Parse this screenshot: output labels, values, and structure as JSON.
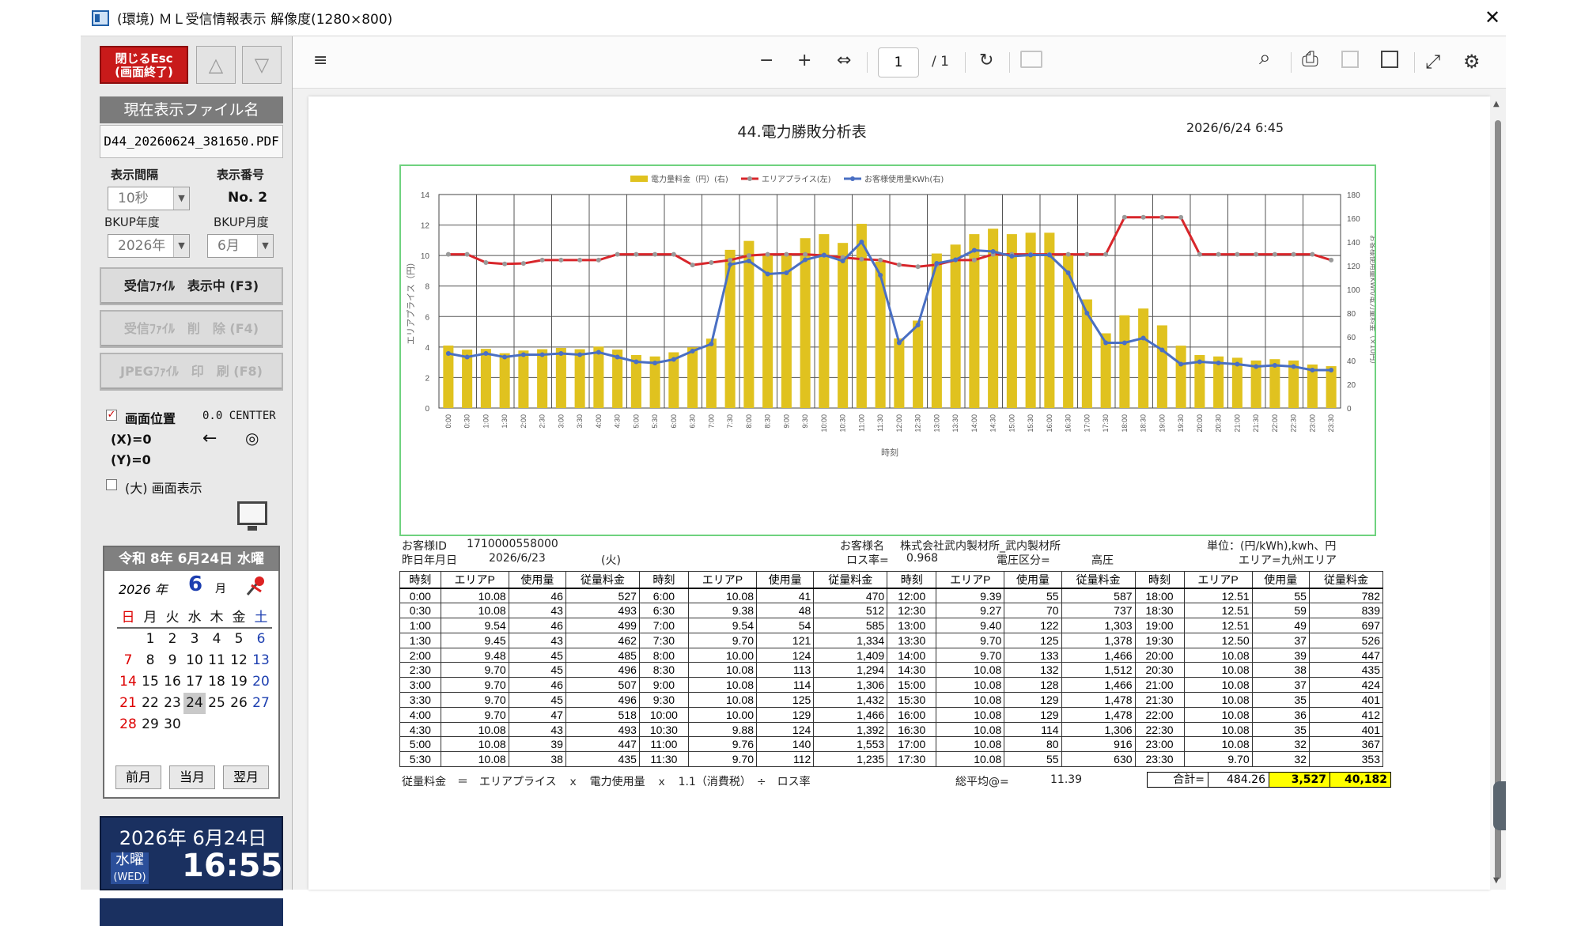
{
  "window": {
    "title": "(環境) ＭＬ受信情報表示 解像度(1280×800)",
    "close": "✕"
  },
  "sidebar": {
    "close_btn": "閉じるEsc\n(画面終了)",
    "up": "△",
    "down": "▽",
    "current_file_label": "現在表示ファイル名",
    "current_file": "D44_20260624_381650.PDF",
    "interval_label": "表示間隔",
    "interval_value": "10秒",
    "number_label": "表示番号",
    "number_value": "No. 2",
    "bkup_year_label": "BKUP年度",
    "bkup_year_value": "2026年",
    "bkup_month_label": "BKUP月度",
    "bkup_month_value": "6月",
    "btn_display": "受信ﾌｧｲﾙ　表示中 (F3)",
    "btn_delete": "受信ﾌｧｲﾙ　削　除 (F4)",
    "btn_print": "JPEGﾌｧｲﾙ　印　刷 (F8)",
    "screen_pos_label": "画面位置",
    "screen_pos_value": "0.0 CENTTER",
    "x_label": "(X)=0",
    "y_label": "(Y)=0",
    "arrow": "←",
    "target": "◎",
    "large_label": "(大) 画面表示",
    "check_mark": "✓"
  },
  "calendar": {
    "header": "令和 8年 6月24日 水曜",
    "year": "2026 年",
    "month": "6",
    "month_label": "月",
    "weekdays": [
      "日",
      "月",
      "火",
      "水",
      "木",
      "金",
      "土"
    ],
    "weeks": [
      [
        "",
        "1",
        "2",
        "3",
        "4",
        "5",
        "6"
      ],
      [
        "7",
        "8",
        "9",
        "10",
        "11",
        "12",
        "13"
      ],
      [
        "14",
        "15",
        "16",
        "17",
        "18",
        "19",
        "20"
      ],
      [
        "21",
        "22",
        "23",
        "24",
        "25",
        "26",
        "27"
      ],
      [
        "28",
        "29",
        "30",
        "",
        "",
        "",
        ""
      ]
    ],
    "today": "24",
    "prev": "前月",
    "current": "当月",
    "next": "翌月"
  },
  "clock": {
    "date": "2026年 6月24日",
    "day": "水曜",
    "day_en": "(WED)",
    "time": "16:55"
  },
  "viewer": {
    "page_current": "1",
    "page_total": "/ 1",
    "icons": {
      "list": "≡",
      "minus": "−",
      "plus": "+",
      "fit": "⇔",
      "rotate": "↻",
      "search": "⌕",
      "print": "⎙",
      "expand": "⤢",
      "settings": "⚙"
    }
  },
  "report": {
    "title": "44.電力勝敗分析表",
    "date": "2026/6/24  6:45",
    "customer_id_label": "お客様ID",
    "customer_id": "1710000558000",
    "yday_label": "昨日年月日",
    "yday": "2026/6/23",
    "yday_week": "(火)",
    "customer_name_label": "お客様名",
    "customer_name": "株式会社武内製材所_武内製材所",
    "loss_label": "ロス率=",
    "loss": "0.968",
    "voltage_label": "電圧区分=",
    "voltage": "高圧",
    "unit_label": "単位：(円/kWh),kwh、円",
    "area_label": "エリア=",
    "area": "九州エリア",
    "table_headers": [
      "時刻",
      "エリアP",
      "使用量",
      "従量料金",
      "時刻",
      "エリアP",
      "使用量",
      "従量料金",
      "時刻",
      "エリアP",
      "使用量",
      "従量料金",
      "時刻",
      "エリアP",
      "使用量",
      "従量料金"
    ],
    "table_rows": [
      [
        "0:00",
        "10.08",
        "46",
        "527",
        "6:00",
        "10.08",
        "41",
        "470",
        "12:00",
        "9.39",
        "55",
        "587",
        "18:00",
        "12.51",
        "55",
        "782"
      ],
      [
        "0:30",
        "10.08",
        "43",
        "493",
        "6:30",
        "9.38",
        "48",
        "512",
        "12:30",
        "9.27",
        "70",
        "737",
        "18:30",
        "12.51",
        "59",
        "839"
      ],
      [
        "1:00",
        "9.54",
        "46",
        "499",
        "7:00",
        "9.54",
        "54",
        "585",
        "13:00",
        "9.40",
        "122",
        "1,303",
        "19:00",
        "12.51",
        "49",
        "697"
      ],
      [
        "1:30",
        "9.45",
        "43",
        "462",
        "7:30",
        "9.70",
        "121",
        "1,334",
        "13:30",
        "9.70",
        "125",
        "1,378",
        "19:30",
        "12.50",
        "37",
        "526"
      ],
      [
        "2:00",
        "9.48",
        "45",
        "485",
        "8:00",
        "10.00",
        "124",
        "1,409",
        "14:00",
        "9.70",
        "133",
        "1,466",
        "20:00",
        "10.08",
        "39",
        "447"
      ],
      [
        "2:30",
        "9.70",
        "45",
        "496",
        "8:30",
        "10.08",
        "113",
        "1,294",
        "14:30",
        "10.08",
        "132",
        "1,512",
        "20:30",
        "10.08",
        "38",
        "435"
      ],
      [
        "3:00",
        "9.70",
        "46",
        "507",
        "9:00",
        "10.08",
        "114",
        "1,306",
        "15:00",
        "10.08",
        "128",
        "1,466",
        "21:00",
        "10.08",
        "37",
        "424"
      ],
      [
        "3:30",
        "9.70",
        "45",
        "496",
        "9:30",
        "10.08",
        "125",
        "1,432",
        "15:30",
        "10.08",
        "129",
        "1,478",
        "21:30",
        "10.08",
        "35",
        "401"
      ],
      [
        "4:00",
        "9.70",
        "47",
        "518",
        "10:00",
        "10.00",
        "129",
        "1,466",
        "16:00",
        "10.08",
        "129",
        "1,478",
        "22:00",
        "10.08",
        "36",
        "412"
      ],
      [
        "4:30",
        "10.08",
        "43",
        "493",
        "10:30",
        "9.88",
        "124",
        "1,392",
        "16:30",
        "10.08",
        "114",
        "1,306",
        "22:30",
        "10.08",
        "35",
        "401"
      ],
      [
        "5:00",
        "10.08",
        "39",
        "447",
        "11:00",
        "9.76",
        "140",
        "1,553",
        "17:00",
        "10.08",
        "80",
        "916",
        "23:00",
        "10.08",
        "32",
        "367"
      ],
      [
        "5:30",
        "10.08",
        "38",
        "435",
        "11:30",
        "9.70",
        "112",
        "1,235",
        "17:30",
        "10.08",
        "55",
        "630",
        "23:30",
        "9.70",
        "32",
        "353"
      ]
    ],
    "formula": "従量料金　＝　エリアプライス　ｘ　電力使用量　ｘ　1.1（消費税）　÷　ロス率",
    "avg_label": "総平均@=",
    "avg": "11.39",
    "total_label": "合計=",
    "total_price": "484.26",
    "total_usage": "3,527",
    "total_charge": "40,182",
    "highlight": "#ffff00"
  },
  "chart_data": {
    "type": "bar",
    "title": "",
    "legend": [
      "電力量料金（円）(右)",
      "エリアプライス(左)",
      "お客様使用量KWh(右)"
    ],
    "legend_placement": "top",
    "xlabel": "時刻",
    "ylabel": "エリアプライス（円）",
    "ylabel_right": "お客様使用量KWh/電力量料金（×10円）",
    "ylim": [
      0,
      14
    ],
    "ylim_right": [
      0,
      180
    ],
    "yticks": [
      "0",
      "2",
      "4",
      "6",
      "8",
      "10",
      "12",
      "14"
    ],
    "yticks_right": [
      "0",
      "20",
      "40",
      "60",
      "80",
      "100",
      "120",
      "140",
      "160",
      "180"
    ],
    "categories": [
      "0:00",
      "0:30",
      "1:00",
      "1:30",
      "2:00",
      "2:30",
      "3:00",
      "3:30",
      "4:00",
      "4:30",
      "5:00",
      "5:30",
      "6:00",
      "6:30",
      "7:00",
      "7:30",
      "8:00",
      "8:30",
      "9:00",
      "9:30",
      "10:00",
      "10:30",
      "11:00",
      "11:30",
      "12:00",
      "12:30",
      "13:00",
      "13:30",
      "14:00",
      "14:30",
      "15:00",
      "15:30",
      "16:00",
      "16:30",
      "17:00",
      "17:30",
      "18:00",
      "18:30",
      "19:00",
      "19:30",
      "20:00",
      "20:30",
      "21:00",
      "21:30",
      "22:00",
      "22:30",
      "23:00",
      "23:30"
    ],
    "series": [
      {
        "name": "電力量料金（円）(右)",
        "axis": "right",
        "kind": "bar",
        "color": "#e0c21f",
        "values": [
          52.7,
          49.3,
          49.9,
          46.2,
          48.5,
          49.6,
          50.7,
          49.6,
          51.8,
          49.3,
          44.7,
          43.5,
          47.0,
          51.2,
          58.5,
          133.4,
          140.9,
          129.4,
          130.6,
          143.2,
          146.6,
          139.2,
          155.3,
          123.5,
          58.7,
          73.7,
          130.3,
          137.8,
          146.6,
          151.2,
          146.6,
          147.8,
          147.8,
          130.6,
          91.6,
          63.0,
          78.2,
          83.9,
          69.7,
          52.6,
          44.7,
          43.5,
          42.4,
          40.1,
          41.2,
          40.1,
          36.7,
          35.3
        ]
      },
      {
        "name": "エリアプライス(左)",
        "axis": "left",
        "kind": "line",
        "color": "#d8262b",
        "values": [
          10.08,
          10.08,
          9.54,
          9.45,
          9.48,
          9.7,
          9.7,
          9.7,
          9.7,
          10.08,
          10.08,
          10.08,
          10.08,
          9.38,
          9.54,
          9.7,
          10.0,
          10.08,
          10.08,
          10.08,
          10.0,
          9.88,
          9.76,
          9.7,
          9.39,
          9.27,
          9.4,
          9.7,
          9.7,
          10.08,
          10.08,
          10.08,
          10.08,
          10.08,
          10.08,
          10.08,
          12.51,
          12.51,
          12.51,
          12.5,
          10.08,
          10.08,
          10.08,
          10.08,
          10.08,
          10.08,
          10.08,
          9.7
        ]
      },
      {
        "name": "お客様使用量KWh(右)",
        "axis": "right",
        "kind": "line",
        "color": "#4a6fc3",
        "values": [
          46,
          43,
          46,
          43,
          45,
          45,
          46,
          45,
          47,
          43,
          39,
          38,
          41,
          48,
          54,
          121,
          124,
          113,
          114,
          125,
          129,
          124,
          140,
          112,
          55,
          70,
          122,
          125,
          133,
          132,
          128,
          129,
          129,
          114,
          80,
          55,
          55,
          59,
          49,
          37,
          39,
          38,
          37,
          35,
          36,
          35,
          32,
          32
        ]
      }
    ]
  }
}
